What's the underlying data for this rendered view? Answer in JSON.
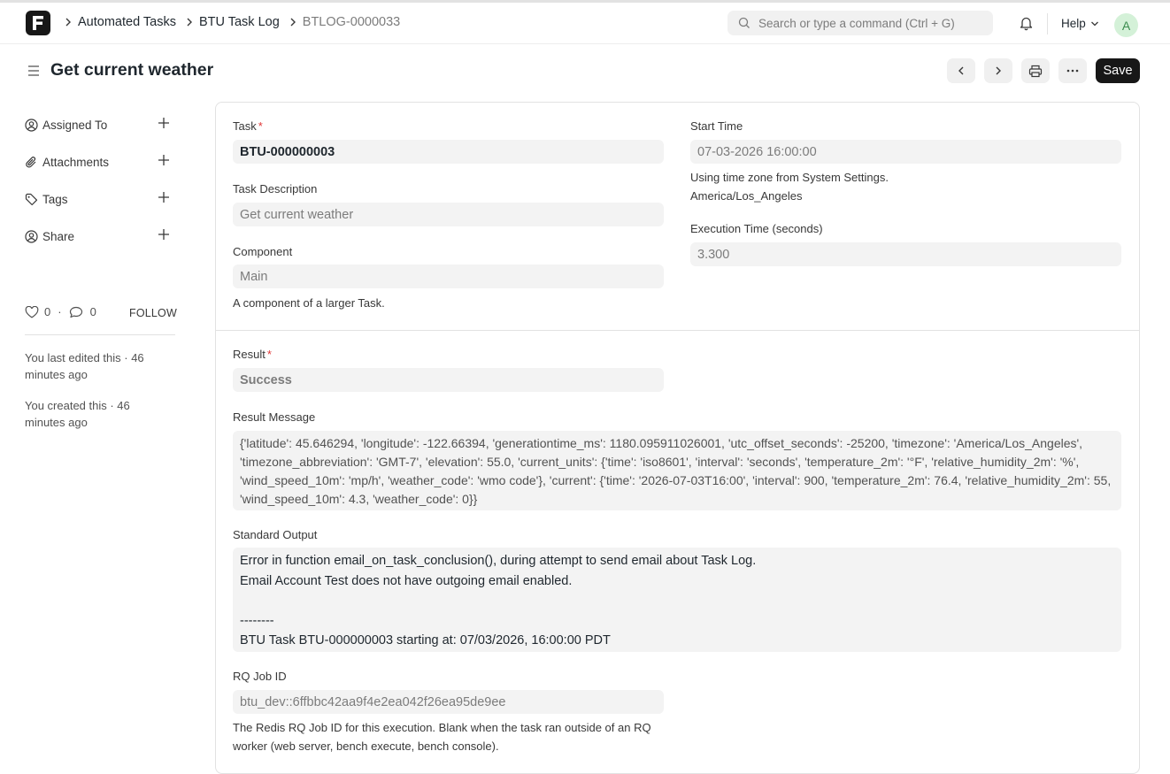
{
  "breadcrumbs": [
    "Automated Tasks",
    "BTU Task Log",
    "BTLOG-0000033"
  ],
  "navbar": {
    "search_placeholder": "Search or type a command (Ctrl + G)",
    "help_label": "Help",
    "avatar_letter": "A"
  },
  "page": {
    "title": "Get current weather",
    "save_label": "Save"
  },
  "sidebar": {
    "items": [
      {
        "label": "Assigned To",
        "icon": "assign-user-icon"
      },
      {
        "label": "Attachments",
        "icon": "paperclip-icon"
      },
      {
        "label": "Tags",
        "icon": "tag-icon"
      },
      {
        "label": "Share",
        "icon": "share-user-icon"
      }
    ],
    "likes_count": "0",
    "comments_count": "0",
    "follow_label": "FOLLOW",
    "timeline": [
      "You last edited this · 46 minutes ago",
      "You created this · 46 minutes ago"
    ]
  },
  "form": {
    "task_label": "Task",
    "task_value": "BTU-000000003",
    "task_description_label": "Task Description",
    "task_description_value": "Get current weather",
    "component_label": "Component",
    "component_value": "Main",
    "component_help": "A component of a larger Task.",
    "start_time_label": "Start Time",
    "start_time_value": "07-03-2026 16:00:00",
    "timezone_help_1": "Using time zone from System Settings.",
    "timezone_help_2": "America/Los_Angeles",
    "execution_time_label": "Execution Time (seconds)",
    "execution_time_value": "3.300",
    "result_label": "Result",
    "result_value": "Success",
    "result_message_label": "Result Message",
    "result_message_value": "{'latitude': 45.646294, 'longitude': -122.66394, 'generationtime_ms': 1180.095911026001, 'utc_offset_seconds': -25200, 'timezone': 'America/Los_Angeles', 'timezone_abbreviation': 'GMT-7', 'elevation': 55.0, 'current_units': {'time': 'iso8601', 'interval': 'seconds', 'temperature_2m': '°F', 'relative_humidity_2m': '%', 'wind_speed_10m': 'mp/h', 'weather_code': 'wmo code'}, 'current': {'time': '2026-07-03T16:00', 'interval': 900, 'temperature_2m': 76.4, 'relative_humidity_2m': 55, 'wind_speed_10m': 4.3, 'weather_code': 0}}",
    "standard_output_label": "Standard Output",
    "standard_output_value": "Error in function email_on_task_conclusion(), during attempt to send email about Task Log.\nEmail Account Test does not have outgoing email enabled.\n\n--------\nBTU Task BTU-000000003 starting at: 07/03/2026, 16:00:00 PDT",
    "rq_job_id_label": "RQ Job ID",
    "rq_job_id_value": "btu_dev::6ffbbc42aa9f4e2ea042f26ea95de9ee",
    "rq_job_id_help": "The Redis RQ Job ID for this execution. Blank when the task ran outside of an RQ worker (web server, bench execute, bench console)."
  }
}
